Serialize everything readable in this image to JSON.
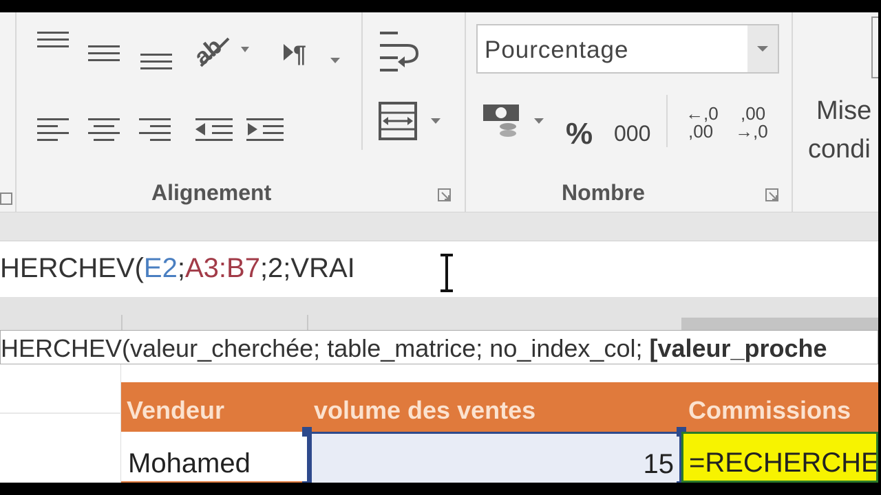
{
  "ribbon": {
    "alignment_label": "Alignement",
    "number_label": "Nombre",
    "number_format_value": "Pourcentage",
    "percent_glyph": "%",
    "thousands_glyph": "000",
    "increase_decimal_top": "←,0",
    "increase_decimal_bottom": ",00",
    "decrease_decimal_top": ",00",
    "decrease_decimal_bottom": "→,0",
    "conditional_line1": "Mise",
    "conditional_line2": "condi"
  },
  "formula_bar": {
    "prefix": "HERCHEV(",
    "ref1": "E2",
    "sep1": ";",
    "ref2": "A3:B7",
    "rest": ";2;VRAI",
    "ref1_color": "#4a7fc1",
    "ref2_color": "#a23b48"
  },
  "tooltip": {
    "text": "HERCHEV(valeur_cherchée; table_matrice; no_index_col; ",
    "optional_arg": "[valeur_proche"
  },
  "table": {
    "header_color": "#e07a3c",
    "headers": [
      "Vendeur",
      "volume des ventes",
      "Commissions"
    ],
    "row": {
      "vendor": "Mohamed",
      "volume": "15",
      "commission_formula": "=RECHERCHEV"
    },
    "selection_color": "#2e4a8c",
    "formula_cell_color": "#f7f300"
  },
  "icons": [
    "align-top-icon",
    "align-middle-icon",
    "align-bottom-icon",
    "orientation-icon",
    "paragraph-direction-icon",
    "wrap-text-icon",
    "align-left-icon",
    "align-center-icon",
    "align-right-icon",
    "decrease-indent-icon",
    "increase-indent-icon",
    "merge-center-icon",
    "accounting-format-icon",
    "percent-icon",
    "thousands-icon",
    "increase-decimal-icon",
    "decrease-decimal-icon",
    "dialog-launcher-icon",
    "dropdown-arrow-icon",
    "text-cursor-icon"
  ]
}
